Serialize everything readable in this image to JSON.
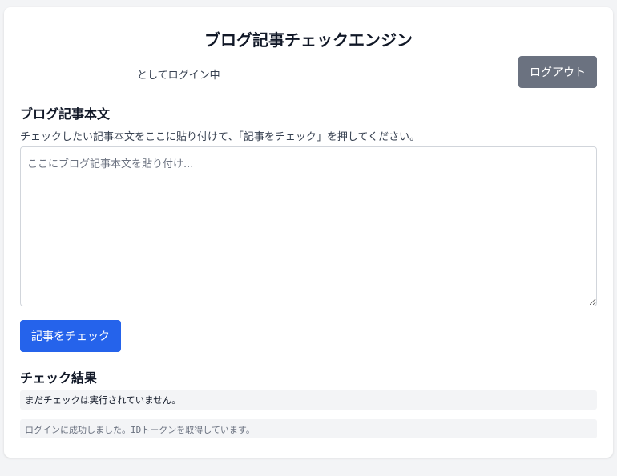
{
  "app": {
    "title": "ブログ記事チェックエンジン"
  },
  "header": {
    "login_status": "としてログイン中",
    "logout_label": "ログアウト"
  },
  "article": {
    "heading": "ブログ記事本文",
    "instruction": "チェックしたい記事本文をここに貼り付けて、「記事をチェック」を押してください。",
    "placeholder": "ここにブログ記事本文を貼り付け...",
    "value": "",
    "check_label": "記事をチェック"
  },
  "results": {
    "heading": "チェック結果",
    "status": "まだチェックは実行されていません。"
  },
  "log": {
    "message": "ログインに成功しました。IDトークンを取得しています。"
  },
  "colors": {
    "primary": "#2563eb",
    "secondary": "#6b7280",
    "panel": "#f3f4f6"
  }
}
